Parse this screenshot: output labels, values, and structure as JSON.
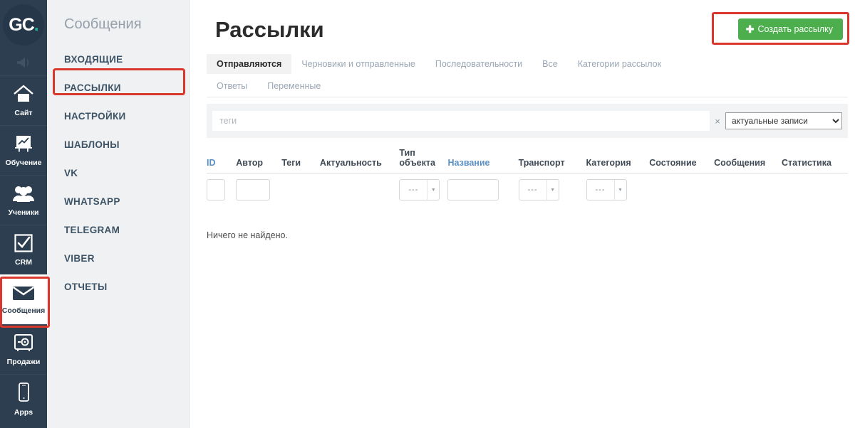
{
  "rail": {
    "logo": {
      "part1": "GC",
      "part2": "."
    },
    "megaphone_icon": "megaphone-icon",
    "items": [
      {
        "label": "Сайт",
        "icon": "home-icon",
        "active": false
      },
      {
        "label": "Обучение",
        "icon": "chart-board-icon",
        "active": false
      },
      {
        "label": "Ученики",
        "icon": "users-icon",
        "active": false
      },
      {
        "label": "CRM",
        "icon": "checkbox-icon",
        "active": false
      },
      {
        "label": "Сообщения",
        "icon": "envelope-icon",
        "active": true
      },
      {
        "label": "Продажи",
        "icon": "safe-icon",
        "active": false
      },
      {
        "label": "Apps",
        "icon": "phone-icon",
        "active": false
      }
    ]
  },
  "sidebar": {
    "title": "Сообщения",
    "items": [
      {
        "label": "ВХОДЯЩИЕ"
      },
      {
        "label": "РАССЫЛКИ"
      },
      {
        "label": "НАСТРОЙКИ"
      },
      {
        "label": "ШАБЛОНЫ"
      },
      {
        "label": "VK"
      },
      {
        "label": "WHATSAPP"
      },
      {
        "label": "TELEGRAM"
      },
      {
        "label": "VIBER"
      },
      {
        "label": "ОТЧЕТЫ"
      }
    ]
  },
  "main": {
    "page_title": "Рассылки",
    "create_button": {
      "label": "Создать рассылку",
      "icon": "plus-icon",
      "color": "#4cae4c"
    },
    "highlight_color": "#d9372b",
    "tabs_row1": [
      {
        "label": "Отправляются",
        "active": true
      },
      {
        "label": "Черновики и отправленные",
        "active": false
      },
      {
        "label": "Последовательности",
        "active": false
      },
      {
        "label": "Все",
        "active": false
      },
      {
        "label": "Категории рассылок",
        "active": false
      }
    ],
    "tabs_row2": [
      {
        "label": "Ответы",
        "active": false
      },
      {
        "label": "Переменные",
        "active": false
      }
    ],
    "filter": {
      "tags_placeholder": "теги",
      "tags_value": "",
      "clear_icon": "×",
      "scope_selected": "актуальные записи"
    },
    "table": {
      "columns": [
        {
          "label": "ID",
          "link": true
        },
        {
          "label": "Автор",
          "link": false
        },
        {
          "label": "Теги",
          "link": false
        },
        {
          "label": "Актуальность",
          "link": false
        },
        {
          "label": "Тип объекта",
          "link": false
        },
        {
          "label": "Название",
          "link": true
        },
        {
          "label": "Транспорт",
          "link": false
        },
        {
          "label": "Категория",
          "link": false
        },
        {
          "label": "Состояние",
          "link": false
        },
        {
          "label": "Сообщения",
          "link": false
        },
        {
          "label": "Статистика",
          "link": false
        }
      ],
      "filter_row": {
        "id_value": "",
        "author_value": "",
        "object_type_value": "---",
        "name_value": "",
        "transport_value": "---",
        "category_value": "---"
      },
      "empty_message": "Ничего не найдено."
    }
  }
}
